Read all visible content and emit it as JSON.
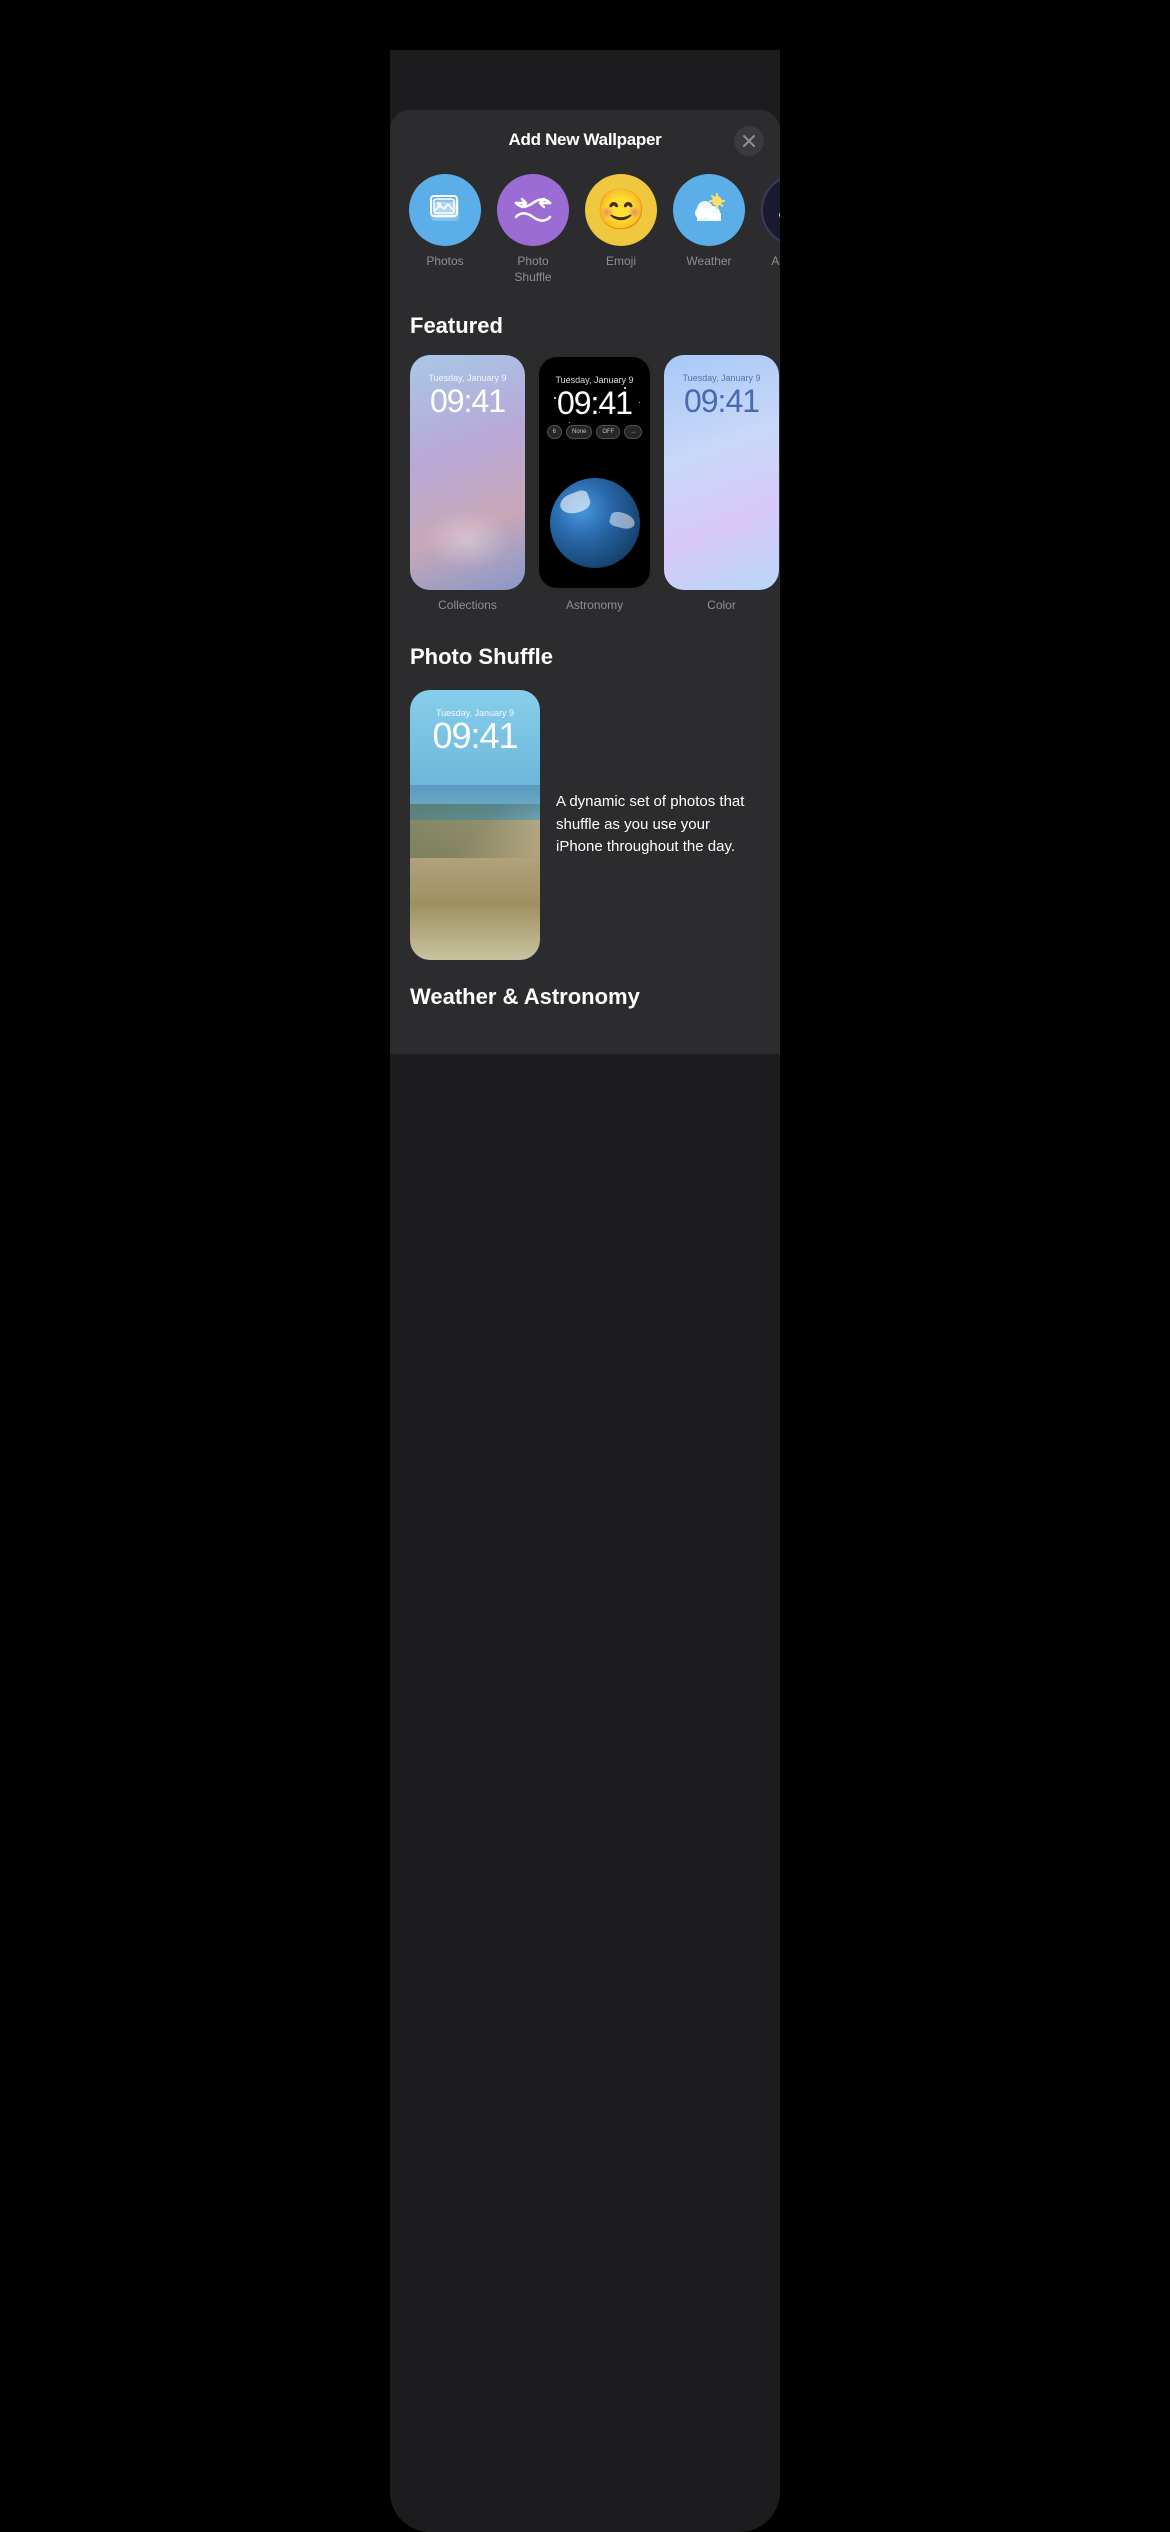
{
  "modal": {
    "title": "Add New Wallpaper",
    "close_icon": "×"
  },
  "categories": [
    {
      "id": "photos",
      "label": "Photos",
      "icon_color": "#5baee8",
      "icon": "photos"
    },
    {
      "id": "photo-shuffle",
      "label": "Photo\nShuffle",
      "icon_color": "#9b6dd4",
      "icon": "shuffle"
    },
    {
      "id": "emoji",
      "label": "Emoji",
      "icon_color": "#f0c840",
      "icon": "emoji"
    },
    {
      "id": "weather",
      "label": "Weather",
      "icon_color": "#5baee8",
      "icon": "weather"
    },
    {
      "id": "astronomy",
      "label": "Astrono...",
      "icon_color": "#1a1a2e",
      "icon": "astronomy"
    }
  ],
  "featured": {
    "title": "Featured",
    "cards": [
      {
        "id": "collections",
        "label": "Collections",
        "date": "Tuesday, January 9",
        "time": "09:41"
      },
      {
        "id": "astronomy",
        "label": "Astronomy",
        "date": "Tuesday, January 9",
        "time": "09:41"
      },
      {
        "id": "color",
        "label": "Color",
        "date": "Tuesday, January 9",
        "time": "09:41"
      }
    ]
  },
  "photo_shuffle": {
    "title": "Photo Shuffle",
    "date": "Tuesday, January 9",
    "time": "09:41",
    "description": "A dynamic set of photos that shuffle as you use your iPhone throughout the day."
  },
  "weather_astronomy": {
    "title": "Weather & Astronomy"
  }
}
